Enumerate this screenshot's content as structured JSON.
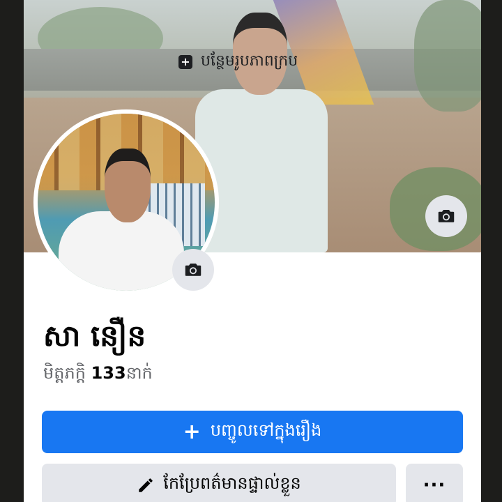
{
  "cover": {
    "add_cover_label": "បន្ថែមរូបភាពក្រប",
    "add_cover_icon": "add-photo-icon",
    "camera_icon": "camera-icon"
  },
  "profile": {
    "avatar_camera_icon": "camera-icon",
    "name": "សា នឿន",
    "friends_label": "មិត្តភក្តិ",
    "friends_count": "133",
    "friends_unit": "នាក់"
  },
  "actions": {
    "add_story_label": "បញ្ចូលទៅក្នុងរឿង",
    "add_story_icon": "plus-icon",
    "edit_profile_label": "កែប្រែពត៌មានផ្ទាល់ខ្លួន",
    "edit_profile_icon": "pencil-icon",
    "more_label": "···"
  },
  "colors": {
    "primary_button": "#1877f2",
    "secondary_button": "#e4e6eb",
    "text": "#050505",
    "muted_text": "#65676b"
  }
}
